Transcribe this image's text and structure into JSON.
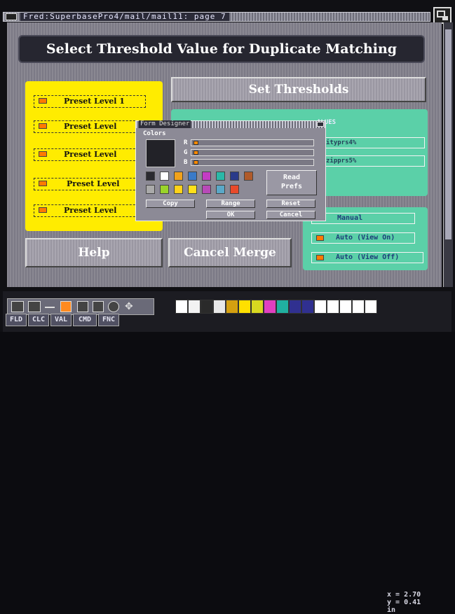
{
  "window": {
    "title": "Fred:SuperbasePro4/mail/mail11: page 7"
  },
  "header": {
    "title": "Select Threshold Value for Duplicate Matching"
  },
  "presets": [
    "Preset Level 1",
    "Preset Level",
    "Preset Level",
    "Preset Level",
    "Preset Level"
  ],
  "buttons": {
    "set_thresholds": "Set Thresholds",
    "help": "Help",
    "cancel_merge": "Cancel Merge"
  },
  "green_panel": {
    "heading_fragment": "ALUES",
    "fields": [
      "ityprs4%",
      "zipprs5%"
    ]
  },
  "mode_options": [
    "Manual",
    "Auto (View On)",
    "Auto (View Off)"
  ],
  "dialog": {
    "title": "Form Designer",
    "colors_label": "Colors",
    "sliders": [
      "R",
      "G",
      "B"
    ],
    "read_prefs": "Read\nPrefs",
    "copy": "Copy",
    "range": "Range",
    "reset": "Reset",
    "ok": "OK",
    "cancel": "Cancel",
    "swatch_colors": [
      "#2a2a30",
      "#ffffff",
      "#f2a21a",
      "#3a7ac8",
      "#c43cc4",
      "#2ab8a8",
      "#2a3a8a",
      "#b05a2a",
      "#aaaaaa",
      "#9ad42a",
      "#ffd21a",
      "#ffe01a",
      "#b84ab8",
      "#5aa8c8",
      "#e84a2a"
    ]
  },
  "toolbar": {
    "buttons": [
      "FLD",
      "CLC",
      "VAL",
      "CMD",
      "FNC"
    ],
    "palette": [
      "#ffffff",
      "#f2f2f2",
      "#2a2a2a",
      "#e8e8e8",
      "#d4a010",
      "#ffe000",
      "#d8d820",
      "#e040c0",
      "#20b0a0",
      "#303090",
      "#303090",
      "#ffffff",
      "#ffffff",
      "#ffffff",
      "#ffffff",
      "#ffffff"
    ],
    "coords": {
      "x": "x = 2.70",
      "y": "y = 0.41",
      "unit": "in"
    }
  }
}
